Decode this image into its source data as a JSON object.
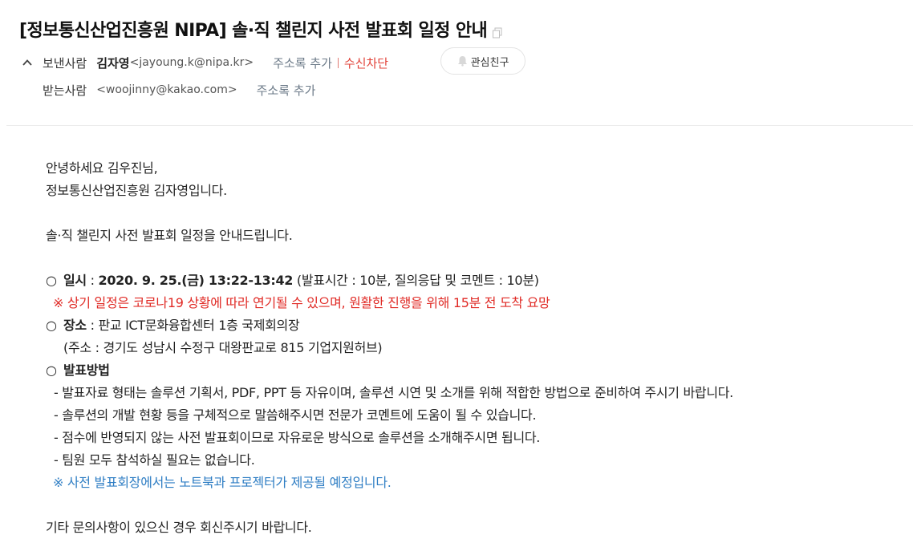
{
  "mail": {
    "subject": "[정보통신산업진흥원 NIPA] 솔·직 챌린지 사전 발표회 일정 안내",
    "sender": {
      "label": "보낸사람",
      "name": "김자영",
      "address": "<jayoung.k@nipa.kr>",
      "add_contact": "주소록 추가",
      "block": "수신차단",
      "vip": "관심친구"
    },
    "recipient": {
      "label": "받는사람",
      "address": "<woojinny@kakao.com>",
      "add_contact": "주소록 추가"
    }
  },
  "body": {
    "greeting1": "안녕하세요 김우진님,",
    "greeting2": "정보통신산업진흥원 김자영입니다.",
    "intro": "솔·직 챌린지 사전 발표회 일정을 안내드립니다.",
    "bullet": "○",
    "date": {
      "label": "일시",
      "colon": " : ",
      "value": "2020. 9. 25.(금) 13:22-13:42",
      "detail": " (발표시간 : 10분, 질의응답 및 코멘트 : 10분)",
      "note": "※ 상기 일정은 코로나19 상황에 따라 연기될 수 있으며, 원활한 진행을 위해 15분 전 도착 요망"
    },
    "place": {
      "label": "장소",
      "value": " : 판교 ICT문화융합센터 1층 국제회의장",
      "address": "(주소 : 경기도 성남시 수정구 대왕판교로 815 기업지원허브)"
    },
    "method": {
      "label": "발표방법",
      "items": [
        "- 발표자료 형태는 솔루션 기획서, PDF, PPT 등 자유이며, 솔루션 시연 및 소개를 위해 적합한 방법으로 준비하여 주시기 바랍니다.",
        "- 솔루션의 개발 현황 등을 구체적으로 말씀해주시면 전문가 코멘트에 도움이 될 수 있습니다.",
        "- 점수에 반영되지 않는 사전 발표회이므로 자유로운 방식으로 솔루션을 소개해주시면 됩니다.",
        "- 팀원 모두 참석하실 필요는 없습니다."
      ],
      "note": "※ 사전 발표회장에서는 노트북과 프로젝터가 제공될 예정입니다."
    },
    "closing": "기타 문의사항이 있으신 경우 회신주시기 바랍니다."
  },
  "icons": {
    "copy": "copy-icon",
    "collapse": "chevron-up-icon",
    "vip": "bell-icon"
  },
  "colors": {
    "red_text": "#e02a25",
    "blue_text": "#2f7ec4",
    "link_gray": "#6d7b89",
    "block_red": "#e2433a"
  }
}
